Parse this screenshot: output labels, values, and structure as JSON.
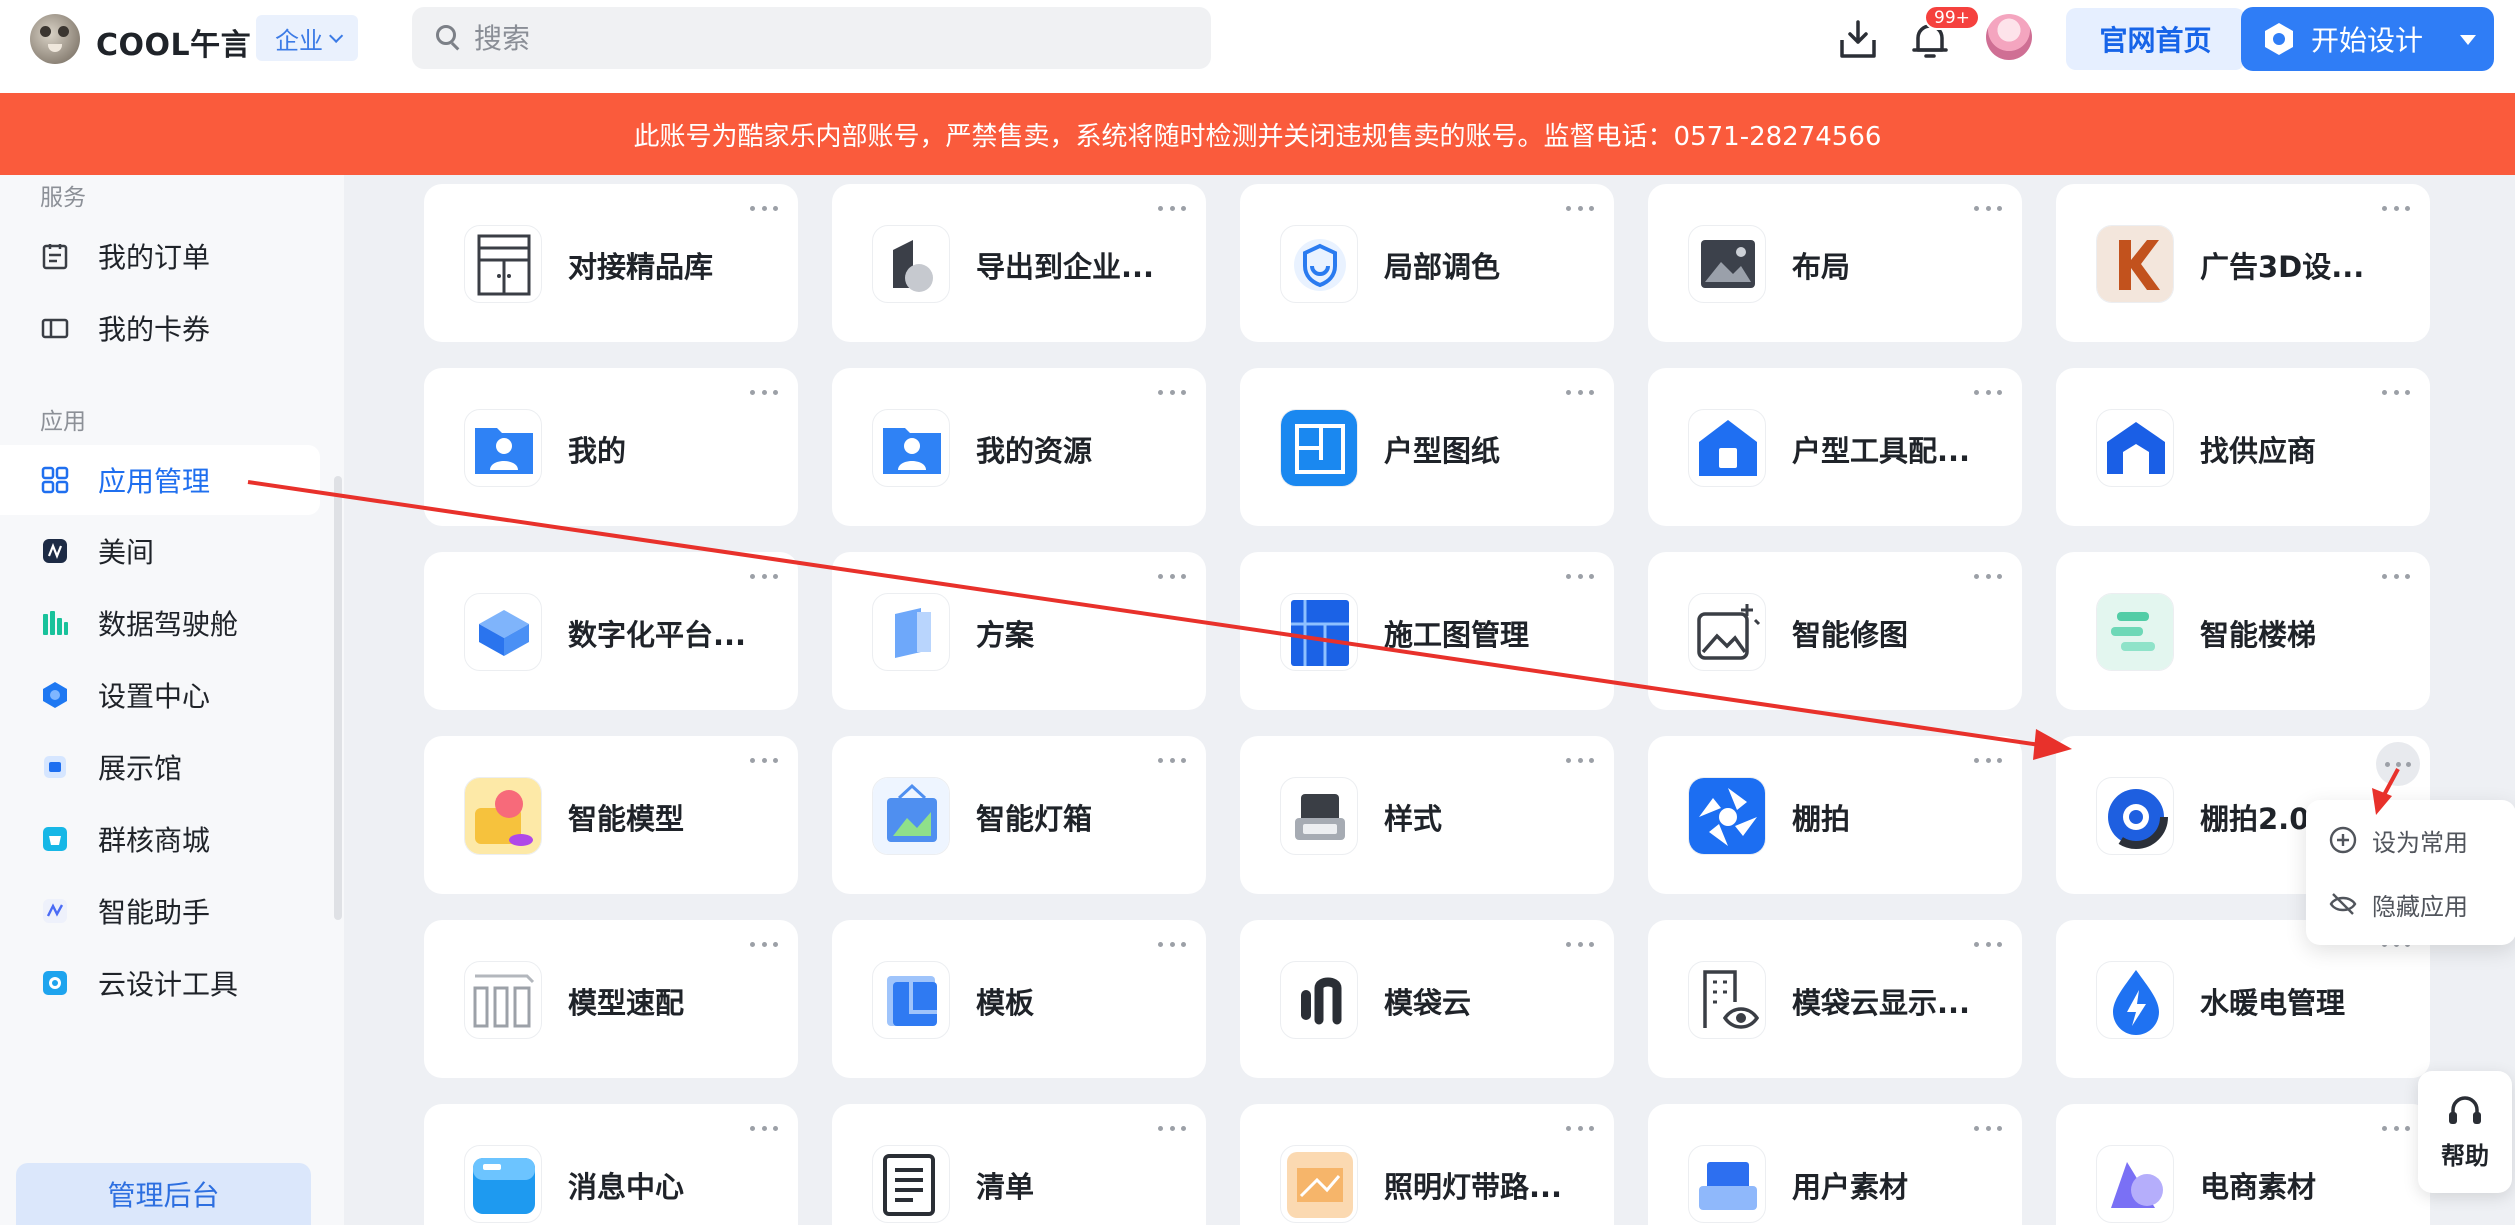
{
  "header": {
    "brand": "COOL午言",
    "org_switch": "企业",
    "search_placeholder": "搜索",
    "notification_count": "99+",
    "site_home": "官网首页",
    "start_design": "开始设计"
  },
  "banner": {
    "text": "此账号为酷家乐内部账号，严禁售卖，系统将随时检测并关闭违规售卖的账号。监督电话：0571-28274566"
  },
  "sidebar": {
    "section_service": "服务",
    "section_apps": "应用",
    "items": [
      {
        "label": "我的订单",
        "icon": "order-icon"
      },
      {
        "label": "我的卡券",
        "icon": "coupon-icon"
      },
      {
        "label": "应用管理",
        "icon": "grid-icon",
        "active": true
      },
      {
        "label": "美间",
        "icon": "meijian-icon"
      },
      {
        "label": "数据驾驶舱",
        "icon": "data-cockpit-icon"
      },
      {
        "label": "设置中心",
        "icon": "settings-hex-icon"
      },
      {
        "label": "展示馆",
        "icon": "showroom-icon"
      },
      {
        "label": "群核商城",
        "icon": "mall-icon"
      },
      {
        "label": "智能助手",
        "icon": "assistant-icon"
      },
      {
        "label": "云设计工具",
        "icon": "cloud-design-icon"
      }
    ],
    "admin_button": "管理后台"
  },
  "apps": [
    {
      "name": "对接精品库",
      "icon": "cabinet-icon"
    },
    {
      "name": "导出到企业...",
      "icon": "export-icon"
    },
    {
      "name": "局部调色",
      "icon": "color-shield-icon"
    },
    {
      "name": "布局",
      "icon": "image-layout-icon"
    },
    {
      "name": "广告3D设...",
      "icon": "k-letter-icon"
    },
    {
      "name": "我的",
      "icon": "user-folder-icon"
    },
    {
      "name": "我的资源",
      "icon": "user-folder-icon"
    },
    {
      "name": "户型图纸",
      "icon": "floorplan-icon"
    },
    {
      "name": "户型工具配...",
      "icon": "house-icon"
    },
    {
      "name": "找供应商",
      "icon": "supplier-icon"
    },
    {
      "name": "数字化平台...",
      "icon": "cube-icon"
    },
    {
      "name": "方案",
      "icon": "scheme-icon"
    },
    {
      "name": "施工图管理",
      "icon": "construction-icon"
    },
    {
      "name": "智能修图",
      "icon": "photo-magic-icon"
    },
    {
      "name": "智能楼梯",
      "icon": "stairs-icon"
    },
    {
      "name": "智能模型",
      "icon": "model-3d-icon"
    },
    {
      "name": "智能灯箱",
      "icon": "lightbox-icon"
    },
    {
      "name": "样式",
      "icon": "style-icon"
    },
    {
      "name": "棚拍",
      "icon": "aperture-icon"
    },
    {
      "name": "棚拍2.0",
      "icon": "ring-icon"
    },
    {
      "name": "模型速配",
      "icon": "bars-icon"
    },
    {
      "name": "模板",
      "icon": "template-icon"
    },
    {
      "name": "模袋云",
      "icon": "mudai-icon"
    },
    {
      "name": "模袋云显示...",
      "icon": "building-eye-icon"
    },
    {
      "name": "水暖电管理",
      "icon": "drop-bolt-icon"
    },
    {
      "name": "消息中心",
      "icon": "message-box-icon"
    },
    {
      "name": "清单",
      "icon": "list-doc-icon"
    },
    {
      "name": "照明灯带路...",
      "icon": "light-strip-icon"
    },
    {
      "name": "用户素材",
      "icon": "user-material-icon"
    },
    {
      "name": "电商素材",
      "icon": "ecommerce-icon"
    }
  ],
  "context_menu": {
    "set_common": "设为常用",
    "hide_app": "隐藏应用"
  },
  "help": "帮助",
  "colors": {
    "primary": "#2f7df6",
    "banner": "#fa5b3c",
    "annotation": "#e8312b"
  }
}
